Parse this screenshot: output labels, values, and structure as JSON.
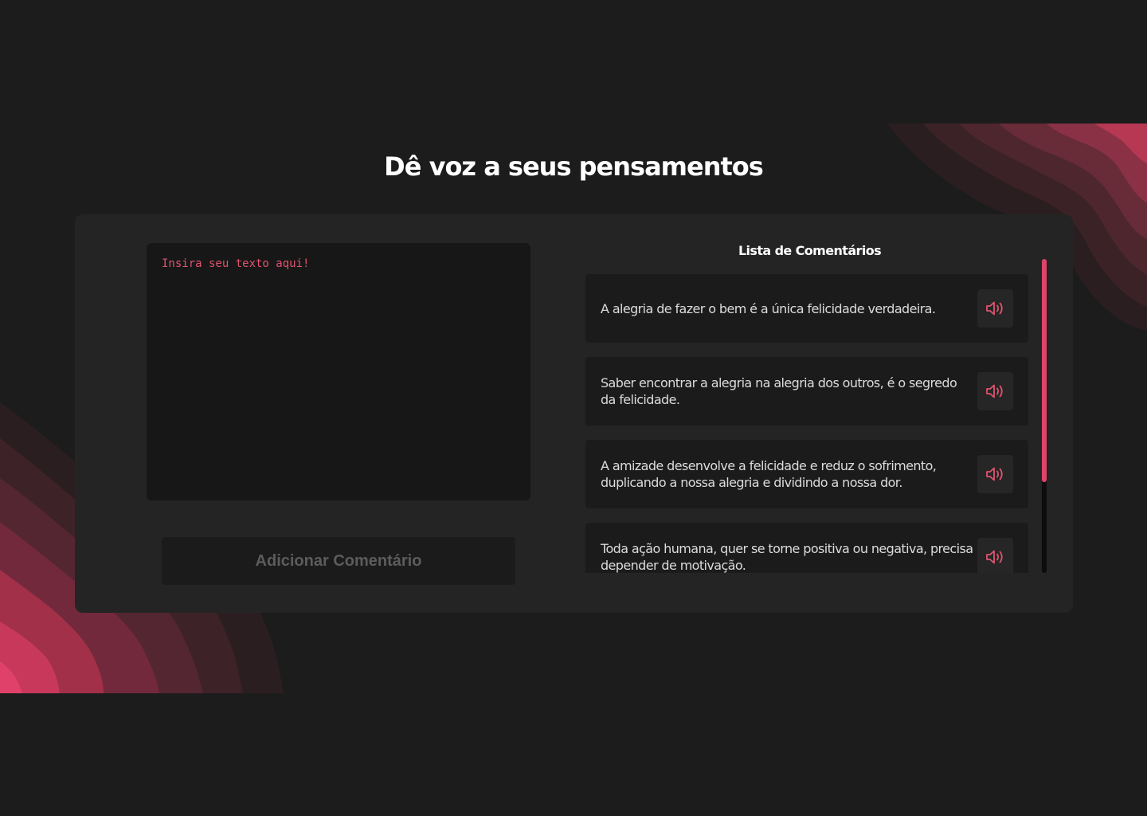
{
  "header": {
    "title": "Dê voz a seus pensamentos"
  },
  "editor": {
    "placeholder": "Insira seu texto aqui!",
    "value": ""
  },
  "add_button": {
    "label": "Adicionar Comentário"
  },
  "comments": {
    "title": "Lista de Comentários",
    "items": [
      {
        "text": "A alegria de fazer o bem é a única felicidade verdadeira."
      },
      {
        "text": "Saber encontrar a alegria na alegria dos outros, é o segredo da felicidade."
      },
      {
        "text": "A amizade desenvolve a felicidade e reduz o sofrimento, duplicando a nossa alegria e dividindo a nossa dor."
      },
      {
        "text": "Toda ação humana, quer se torne positiva ou negativa, precisa depender de motivação."
      }
    ],
    "speak_icon": "speaker-volume-icon",
    "scroll_position": 0,
    "scroll_visible_fraction": 0.71
  },
  "colors": {
    "background": "#1c1c1c",
    "panel": "#242424",
    "accent": "#e0446a",
    "text": "#dcdcdc"
  }
}
